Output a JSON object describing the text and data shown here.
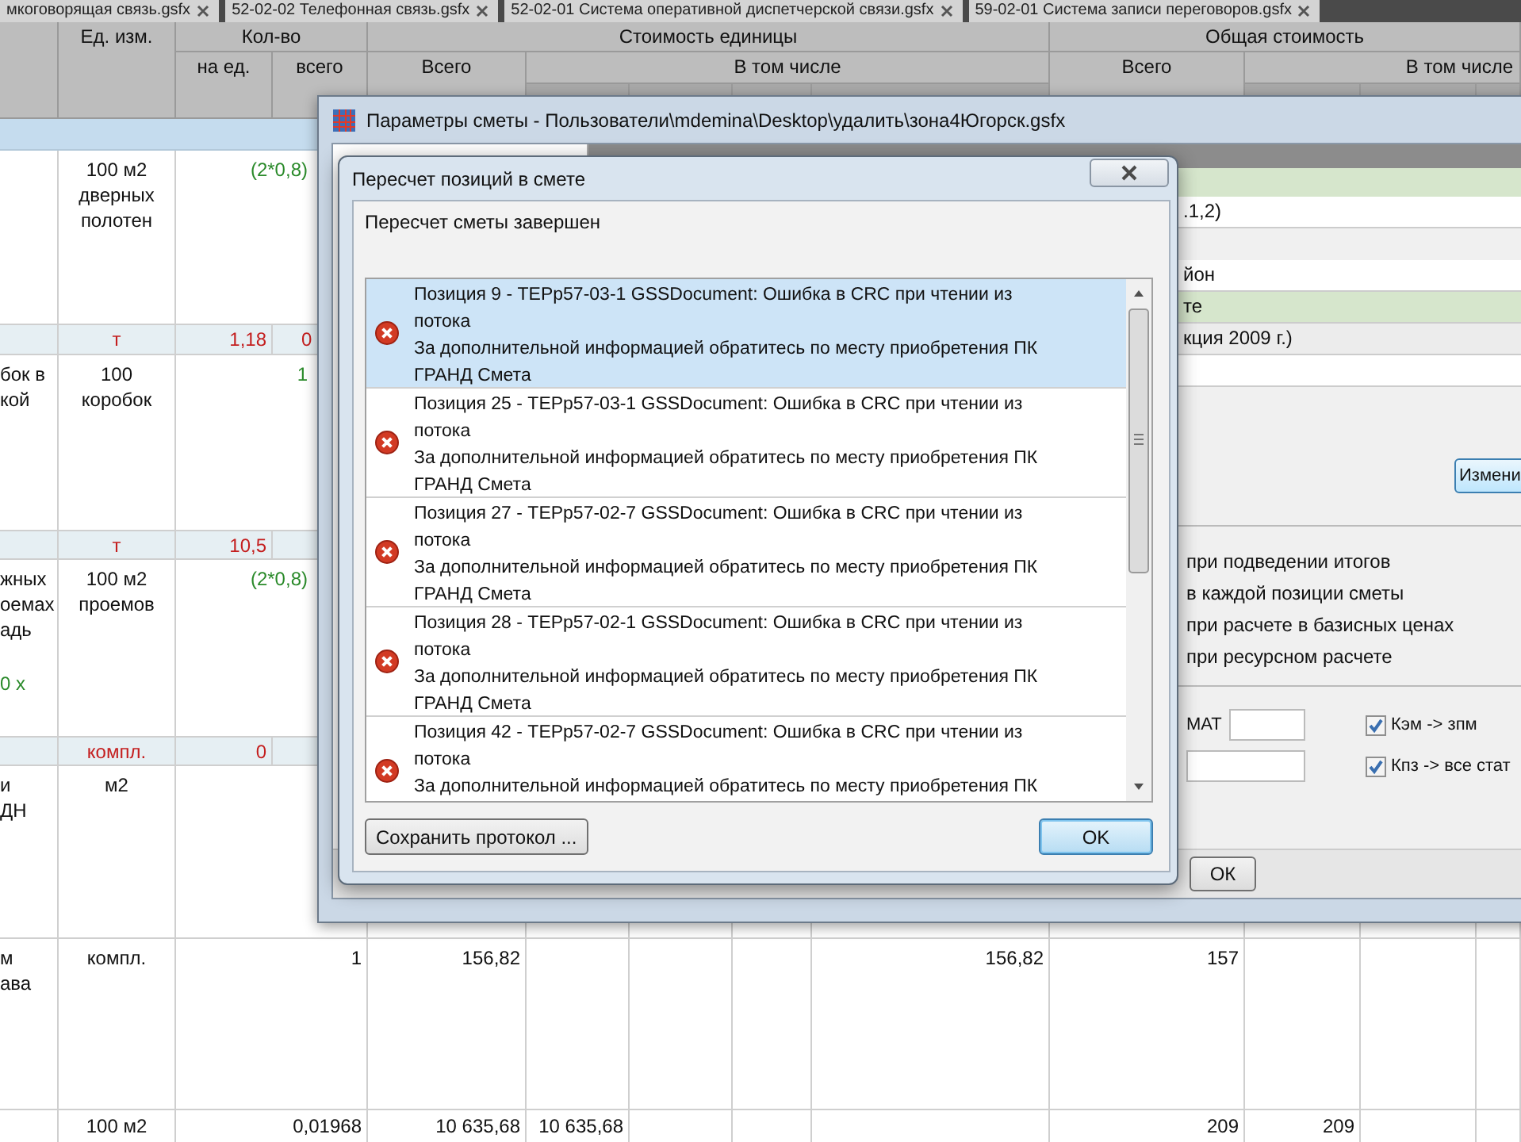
{
  "tabs": [
    {
      "label": "мкоговорящая связь.gsfx"
    },
    {
      "label": "52-02-02 Телефонная связь.gsfx"
    },
    {
      "label": "52-02-01 Система оперативной диспетчерской связи.gsfx"
    },
    {
      "label": "59-02-01 Система записи переговоров.gsfx"
    }
  ],
  "table": {
    "header_cells": [
      "Ед. изм.",
      "Кол-во",
      "на ед.",
      "всего",
      "Стоимость единицы",
      "Всего",
      "В том числе",
      "Общая стоимость",
      "Всего",
      "В том числе"
    ],
    "rows": [
      {
        "kind": "section"
      },
      {
        "kind": "item",
        "cells": {
          "unit": "100 м2 дверных полотен",
          "formula": "(2*0,8)"
        }
      },
      {
        "kind": "resource",
        "cells": {
          "unit": "т",
          "qty_per": "1,18",
          "qty_total": "0"
        }
      },
      {
        "kind": "item",
        "name_lines": [
          "бок в",
          "кой"
        ],
        "cells": {
          "unit": "100 коробок",
          "formula": "1"
        }
      },
      {
        "kind": "resource",
        "cells": {
          "unit": "т",
          "qty_per": "10,5"
        }
      },
      {
        "kind": "item",
        "name_lines": [
          "жных",
          "оемах",
          "адь"
        ],
        "name_note": "0 х",
        "cells": {
          "unit": "100 м2 проемов",
          "formula": "(2*0,8)"
        }
      },
      {
        "kind": "resource",
        "cells": {
          "unit": "компл.",
          "qty_per": "0"
        }
      },
      {
        "kind": "item",
        "name_lines": [
          "и",
          "ДН"
        ],
        "cells": {
          "unit": "м2"
        }
      },
      {
        "kind": "item",
        "name_lines": [
          "м",
          "ава"
        ],
        "cells": {
          "unit": "компл.",
          "qty": "1",
          "unit_total": "156,82",
          "unit_p4": "156,82",
          "total": "157"
        }
      },
      {
        "kind": "item",
        "cells": {
          "unit": "100 м2",
          "qty": "0,01968",
          "unit_total": "10 635,68",
          "unit_p1": "10 635,68",
          "total": "209",
          "total_p1": "209"
        }
      }
    ]
  },
  "params_dialog": {
    "title": "Параметры сметы - Пользователи\\mdemina\\Desktop\\удалить\\зона4Югорск.gsfx",
    "rows": [
      {
        "kind": "white",
        "text": ".1,2)"
      },
      {
        "kind": "white",
        "text": "йон"
      },
      {
        "kind": "green",
        "text": "те"
      },
      {
        "kind": "gray",
        "text": "кция 2009 г.)"
      }
    ],
    "change_button": "Измени",
    "options": [
      "при подведении итогов",
      "в каждой позиции сметы",
      "при расчете в базисных ценах",
      "при ресурсном расчете"
    ],
    "mat_label": "МАТ",
    "checks": [
      {
        "label": "Кэм -> зпм",
        "checked": true
      },
      {
        "label": "Кпз -> все стат",
        "checked": true
      }
    ],
    "ok_button": "ОК"
  },
  "recalc_dialog": {
    "title": "Пересчет позиций в смете",
    "message": "Пересчет сметы завершен",
    "items": [
      {
        "text": "Позиция 9 - ТЕРр57-03-1 GSSDocument: Ошибка в CRC при чтении из потока",
        "hint": "За дополнительной информацией обратитесь по месту приобретения ПК ГРАНД Смета",
        "selected": true
      },
      {
        "text": "Позиция 25 - ТЕРр57-03-1 GSSDocument: Ошибка в CRC при чтении из потока",
        "hint": "За дополнительной информацией обратитесь по месту приобретения ПК ГРАНД Смета",
        "selected": false
      },
      {
        "text": "Позиция 27 - ТЕРр57-02-7 GSSDocument: Ошибка в CRC при чтении из потока",
        "hint": "За дополнительной информацией обратитесь по месту приобретения ПК ГРАНД Смета",
        "selected": false
      },
      {
        "text": "Позиция 28 - ТЕРр57-02-1 GSSDocument: Ошибка в CRC при чтении из потока",
        "hint": "За дополнительной информацией обратитесь по месту приобретения ПК ГРАНД Смета",
        "selected": false
      },
      {
        "text": "Позиция 42 - ТЕРр57-02-7 GSSDocument: Ошибка в CRC при чтении из потока",
        "hint": "За дополнительной информацией обратитесь по месту приобретения ПК",
        "selected": false
      }
    ],
    "save_button": "Сохранить протокол ...",
    "ok_button": "OK"
  }
}
